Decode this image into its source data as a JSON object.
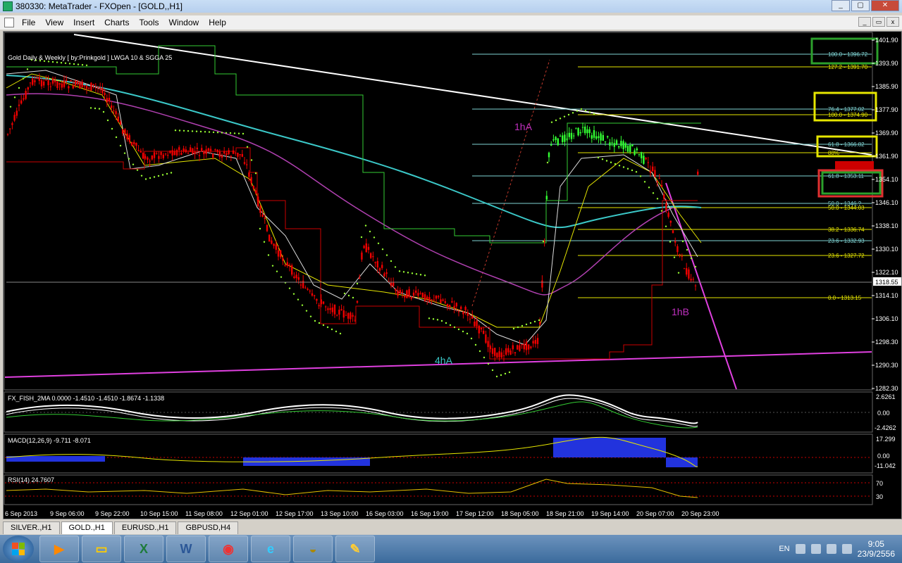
{
  "window": {
    "title": "380330: MetaTrader - FXOpen - [GOLD,,H1]",
    "controls": [
      "_",
      "▢",
      "✕"
    ]
  },
  "menu": [
    "File",
    "View",
    "Insert",
    "Charts",
    "Tools",
    "Window",
    "Help"
  ],
  "chart": {
    "indicator_title": "Gold Daily & Weekly [ by:Prinkgold ]  LWGA 10  &  SGGA 25",
    "current_price": "1318.55",
    "price_axis": [
      "1401.90",
      "1393.90",
      "1385.90",
      "1377.90",
      "1369.90",
      "1361.90",
      "1354.10",
      "1346.10",
      "1338.10",
      "1330.10",
      "1322.10",
      "1314.10",
      "1306.10",
      "1298.30",
      "1290.30",
      "1282.30"
    ],
    "time_axis": [
      "6 Sep 2013",
      "9 Sep 06:00",
      "9 Sep 22:00",
      "10 Sep 15:00",
      "11 Sep 08:00",
      "12 Sep 01:00",
      "12 Sep 17:00",
      "13 Sep 10:00",
      "16 Sep 03:00",
      "16 Sep 19:00",
      "17 Sep 12:00",
      "18 Sep 05:00",
      "18 Sep 21:00",
      "19 Sep 14:00",
      "20 Sep 07:00",
      "20 Sep 23:00"
    ],
    "fib_levels": [
      {
        "label": "100.0 - 1396.72",
        "color": "#7fd4d4"
      },
      {
        "label": "127.2 - 1391.70",
        "color": "#e6e600"
      },
      {
        "label": "76.4 - 1377.02",
        "color": "#7fd4d4"
      },
      {
        "label": "100.0 - 1374.90",
        "color": "#e6e600"
      },
      {
        "label": "61.8 - 1366.82",
        "color": "#7fd4d4"
      },
      {
        "label": "88%",
        "color": "#e6e600"
      },
      {
        "label": "61.8 - 1353.11",
        "color": "#7fd4d4"
      },
      {
        "label": "50.0 - 1346.?",
        "color": "#7fd4d4"
      },
      {
        "label": "50.0 - 1344.03",
        "color": "#e6e600"
      },
      {
        "label": "38.2 - 1336.74",
        "color": "#e6e600"
      },
      {
        "label": "23.6 - 1332.93",
        "color": "#7fd4d4"
      },
      {
        "label": "23.6 - 1327.72",
        "color": "#e6e600"
      },
      {
        "label": "0.0 - 1313.15",
        "color": "#e6e600"
      }
    ],
    "annotations": {
      "a": "1hA",
      "b": "1hB",
      "c": "4hA"
    },
    "panels": {
      "fish": {
        "label": "FX_FISH_2MA 0.0000 -1.4510 -1.4510 -1.8674 -1.1338",
        "axis": [
          "2.6261",
          "0.00",
          "-2.4262"
        ]
      },
      "macd": {
        "label": "MACD(12,26,9) -9.711 -8.071",
        "axis": [
          "17.299",
          "0.00",
          "-11.042"
        ]
      },
      "rsi": {
        "label": "RSI(14) 24.7607",
        "axis": [
          "70",
          "30"
        ]
      }
    }
  },
  "tabs": [
    {
      "label": "SILVER.,H1",
      "active": false
    },
    {
      "label": "GOLD.,H1",
      "active": true
    },
    {
      "label": "EURUSD.,H1",
      "active": false
    },
    {
      "label": "GBPUSD,H4",
      "active": false
    }
  ],
  "taskbar": {
    "apps": [
      "media-icon",
      "folder-icon",
      "excel-icon",
      "word-icon",
      "chrome-icon",
      "ie-icon",
      "metatrader-icon",
      "paint-icon"
    ],
    "lang": "EN",
    "time": "9:05",
    "date": "23/9/2556"
  }
}
